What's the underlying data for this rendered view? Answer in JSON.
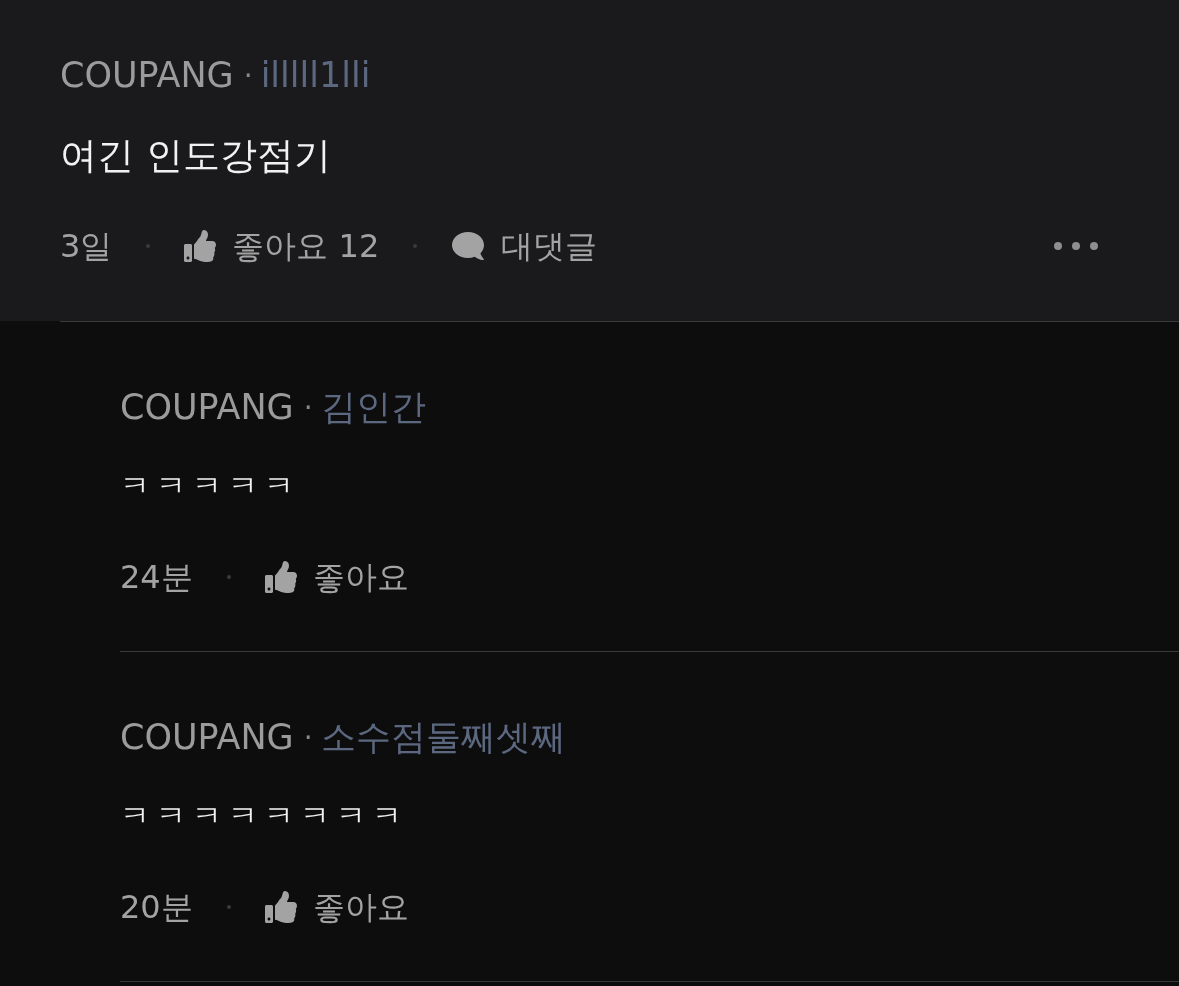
{
  "comment": {
    "company": "COUPANG",
    "separator": "·",
    "author": "illlll1lli",
    "text": "여긴 인도강점기",
    "time": "3일",
    "like_label": "좋아요 12",
    "reply_label": "대댓글"
  },
  "replies": [
    {
      "company": "COUPANG",
      "separator": "·",
      "author": "김인간",
      "text": "ㅋㅋㅋㅋㅋ",
      "time": "24분",
      "like_label": "좋아요"
    },
    {
      "company": "COUPANG",
      "separator": "·",
      "author": "소수점둘째셋째",
      "text": "ㅋㅋㅋㅋㅋㅋㅋㅋ",
      "time": "20분",
      "like_label": "좋아요"
    }
  ]
}
